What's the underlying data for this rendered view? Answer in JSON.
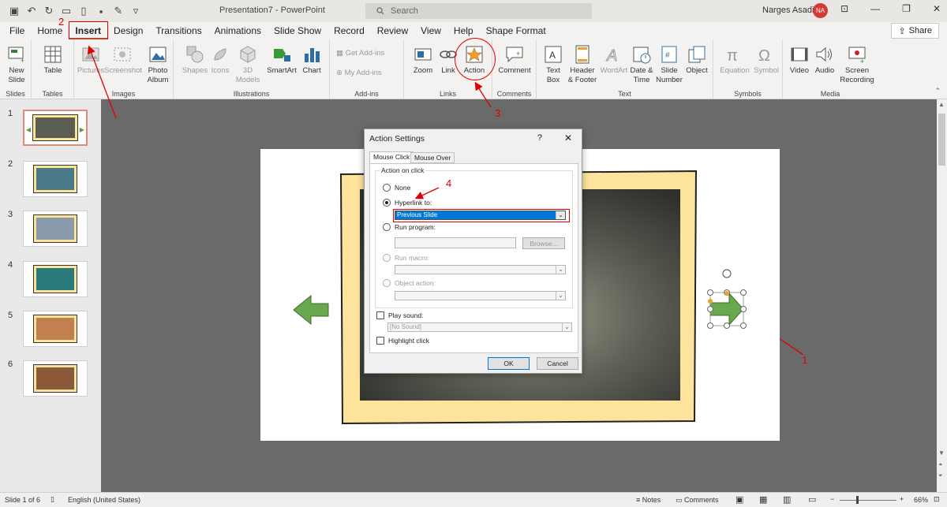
{
  "window": {
    "title": "Presentation7 - PowerPoint",
    "search_placeholder": "Search",
    "user_name": "Narges Asadi",
    "user_initials": "NA",
    "share_label": "Share"
  },
  "tabs": [
    "File",
    "Home",
    "Insert",
    "Design",
    "Transitions",
    "Animations",
    "Slide Show",
    "Record",
    "Review",
    "View",
    "Help",
    "Shape Format"
  ],
  "ribbon": {
    "groups": {
      "slides": "Slides",
      "tables": "Tables",
      "images": "Images",
      "illustrations": "Illustrations",
      "addins": "Add-ins",
      "links": "Links",
      "comments": "Comments",
      "text": "Text",
      "symbols": "Symbols",
      "media": "Media"
    },
    "buttons": {
      "new_slide": "New",
      "new_slide2": "Slide",
      "table": "Table",
      "pictures": "Pictures",
      "screenshot": "Screenshot",
      "photo_album": "Photo",
      "photo_album2": "Album",
      "shapes": "Shapes",
      "icons": "Icons",
      "models": "3D",
      "models2": "Models",
      "smartart": "SmartArt",
      "chart": "Chart",
      "get_addins": "Get Add-ins",
      "my_addins": "My Add-ins",
      "zoom": "Zoom",
      "link": "Link",
      "action": "Action",
      "comment": "Comment",
      "text_box": "Text",
      "text_box2": "Box",
      "header_footer": "Header",
      "header_footer2": "& Footer",
      "wordart": "WordArt",
      "date_time": "Date &",
      "date_time2": "Time",
      "slide_number": "Slide",
      "slide_number2": "Number",
      "object": "Object",
      "equation": "Equation",
      "symbol": "Symbol",
      "video": "Video",
      "audio": "Audio",
      "screen_recording": "Screen",
      "screen_recording2": "Recording"
    }
  },
  "annotations": {
    "a1": "1",
    "a2": "2",
    "a3": "3",
    "a4": "4"
  },
  "slides": [
    "1",
    "2",
    "3",
    "4",
    "5",
    "6"
  ],
  "dialog": {
    "title": "Action Settings",
    "help": "?",
    "close": "✕",
    "tab_mouse_click": "Mouse Click",
    "tab_mouse_over": "Mouse Over",
    "section": "Action on click",
    "none": "None",
    "hyperlink_to": "Hyperlink to:",
    "hyperlink_value": "Previous Slide",
    "run_program": "Run program:",
    "browse": "Browse...",
    "run_macro": "Run macro:",
    "object_action": "Object action:",
    "play_sound": "Play sound:",
    "sound_value": "[No Sound]",
    "highlight_click": "Highlight click",
    "ok": "OK",
    "cancel": "Cancel"
  },
  "status": {
    "slide_info": "Slide 1 of 6",
    "language": "English (United States)",
    "notes": "Notes",
    "comments": "Comments",
    "zoom": "66%"
  }
}
